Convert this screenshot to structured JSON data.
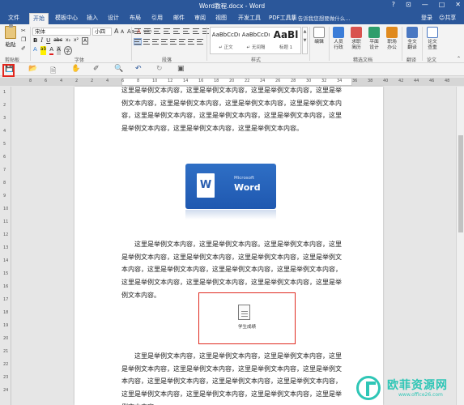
{
  "window": {
    "title": "Word教程.docx - Word",
    "buttons": [
      "?",
      "⊡",
      "—",
      "□",
      "✕"
    ]
  },
  "ribbon_tabs": {
    "items": [
      "文件",
      "开始",
      "模板中心",
      "插入",
      "设计",
      "布局",
      "引用",
      "邮件",
      "审阅",
      "视图",
      "开发工具",
      "PDF工具集"
    ],
    "active": "开始",
    "tell_me": "告诉我您想要做什么...",
    "login": "登录",
    "share": "共享"
  },
  "ribbon": {
    "clipboard": {
      "paste": "粘贴",
      "label": "剪贴板"
    },
    "font": {
      "name": "宋体",
      "size": "小四",
      "grow": "A",
      "shrink": "A",
      "case": "Aa",
      "clear": "A",
      "pinyin": "wén",
      "border_char": "A",
      "bold": "B",
      "italic": "I",
      "underline": "U",
      "strike": "abc",
      "subscript": "x₂",
      "superscript": "x²",
      "effects": "A",
      "highlight": "ab",
      "color": "A",
      "shade": "A",
      "circle": "字",
      "label": "字体"
    },
    "paragraph": {
      "label": "段落"
    },
    "styles": {
      "items": [
        {
          "sample": "AaBbCcDı",
          "name": "↵ 正文"
        },
        {
          "sample": "AaBbCcDı",
          "name": "↵ 无间隔"
        },
        {
          "sample": "AaBl",
          "name": "标题 1"
        }
      ],
      "label": "样式"
    },
    "editing": {
      "label": "编辑"
    },
    "tools": [
      {
        "label": "人员\n行政",
        "color": "#3b7dd8"
      },
      {
        "label": "求职\n简历",
        "color": "#d9534f"
      },
      {
        "label": "平面\n设计",
        "color": "#2e9e6b"
      },
      {
        "label": "职场\n办公",
        "color": "#e08a1e"
      }
    ],
    "tools_label": "精选文档",
    "translate": {
      "label": "全文\n翻译",
      "group": "翻译"
    },
    "check": {
      "label": "论文\n查重",
      "group": "论文"
    }
  },
  "qat": {
    "icons": [
      "save-icon",
      "open-folder-icon",
      "new-doc-icon",
      "touch-mode-icon",
      "format-painter-icon",
      "print-preview-icon",
      "undo-icon",
      "redo-icon",
      "screen-icon"
    ]
  },
  "ruler": {
    "h_ticks": [
      "8",
      "6",
      "4",
      "2",
      "2",
      "4",
      "6",
      "8",
      "10",
      "12",
      "14",
      "16",
      "18",
      "20",
      "22",
      "24",
      "26",
      "28",
      "30",
      "32",
      "34",
      "36",
      "38",
      "40",
      "42",
      "44",
      "46",
      "48"
    ],
    "v_ticks": [
      "1",
      "2",
      "3",
      "4",
      "5",
      "6",
      "7",
      "8",
      "9",
      "10",
      "11",
      "12",
      "13",
      "14",
      "15",
      "16",
      "17",
      "18",
      "19",
      "20",
      "21",
      "22",
      "23",
      "24"
    ]
  },
  "document": {
    "para1": "这里是举例文本内容，这里是举例文本内容，这里是举例文本内容，这里是举例文本内容，这里是举例文本内容，这里是举例文本内容，这里是举例文本内容，这里是举例文本内容，这里是举例文本内容，这里是举例文本内容，这里是举例文本内容，这里是举例文本内容，这里是举例文本内容。",
    "logo_small": "Microsoft",
    "logo_big": "Word",
    "logo_letter": "W",
    "para2": "　　这里是举例文本内容，这里是举例文本内容。这里是举例文本内容，这里是举例文本内容，这里是举例文本内容，这里是举例文本内容，这里是举例文本内容，这里是举例文本内容，这里是举例文本内容，这里是举例文本内容，这里是举例文本内容，这里是举例文本内容，这里是举例文本内容，这里是举例文本内容。",
    "embedded_file": "学生成绩",
    "para3": "　　这里是举例文本内容，这里是举例文本内容，这里是举例文本内容，这里是举例文本内容，这里是举例文本内容，这里是举例文本内容，这里是举例文本内容，这里是举例文本内容，这里是举例文本内容，这里是举例文本内容，这里是举例文本内容，这里是举例文本内容，这里是举例文本内容，这里是举例文本内容。"
  },
  "watermark": {
    "brand": "欧菲资源网",
    "url": "www.office26.com"
  },
  "colors": {
    "ribbon_blue": "#2b579a",
    "highlight_red": "#e3261d",
    "watermark": "#2fc6b6"
  }
}
